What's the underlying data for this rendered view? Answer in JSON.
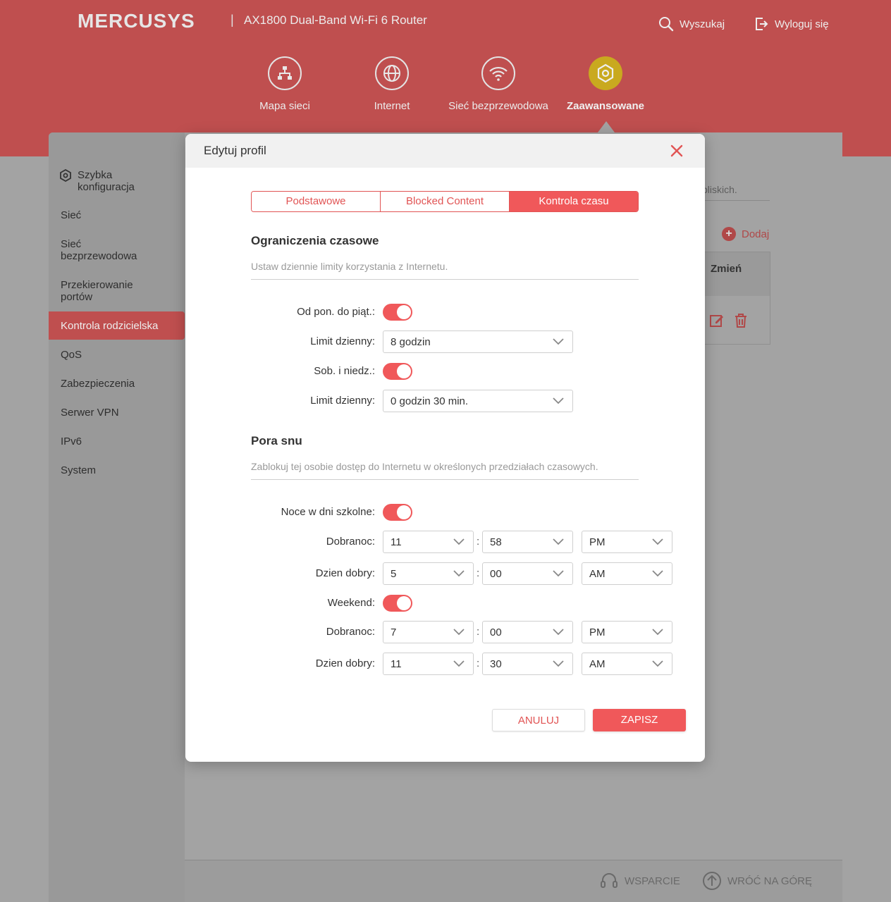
{
  "header": {
    "brand": "MERCUSYS",
    "model": "AX1800 Dual-Band Wi-Fi 6 Router",
    "search_label": "Wyszukaj",
    "logout_label": "Wyloguj się"
  },
  "nav": {
    "items": [
      {
        "label": "Mapa sieci",
        "icon": "network-map-icon"
      },
      {
        "label": "Internet",
        "icon": "globe-icon"
      },
      {
        "label": "Sieć bezprzewodowa",
        "icon": "wifi-icon"
      },
      {
        "label": "Zaawansowane",
        "icon": "gear-icon",
        "active": true
      }
    ]
  },
  "sidebar": {
    "items": [
      {
        "label": "Szybka konfiguracja"
      },
      {
        "label": "Sieć"
      },
      {
        "label": "Sieć bezprzewodowa"
      },
      {
        "label": "Przekierowanie portów"
      },
      {
        "label": "Kontrola rodzicielska",
        "active": true
      },
      {
        "label": "QoS"
      },
      {
        "label": "Zabezpieczenia"
      },
      {
        "label": "Serwer VPN"
      },
      {
        "label": "IPv6"
      },
      {
        "label": "System"
      }
    ]
  },
  "background": {
    "note_fragment": "bliskich.",
    "add_label": "Dodaj",
    "table_header_edit": "Zmień"
  },
  "footer": {
    "support_label": "WSPARCIE",
    "top_label": "WRÓĆ NA GÓRĘ"
  },
  "modal": {
    "title": "Edytuj profil",
    "tabs": [
      "Podstawowe",
      "Blocked Content",
      "Kontrola czasu"
    ],
    "active_tab": "Kontrola czasu",
    "time_limits": {
      "title": "Ograniczenia czasowe",
      "description": "Ustaw dziennie limity korzystania z Internetu.",
      "weekdays_label": "Od pon. do piąt.:",
      "weekdays_enabled": true,
      "weekdays_limit_label": "Limit dzienny:",
      "weekdays_limit": "8 godzin",
      "weekend_label": "Sob. i niedz.:",
      "weekend_enabled": true,
      "weekend_limit_label": "Limit dzienny:",
      "weekend_limit": "0 godzin 30 min."
    },
    "bedtime": {
      "title": "Pora snu",
      "description": "Zablokuj tej osobie dostęp do Internetu w określonych przedziałach czasowych.",
      "school_nights_label": "Noce w dni szkolne:",
      "school_nights_enabled": true,
      "school_bed_label": "Dobranoc:",
      "school_bed": {
        "hour": "11",
        "minute": "58",
        "period": "PM"
      },
      "school_wake_label": "Dzien dobry:",
      "school_wake": {
        "hour": "5",
        "minute": "00",
        "period": "AM"
      },
      "weekend_label": "Weekend:",
      "weekend_enabled": true,
      "weekend_bed_label": "Dobranoc:",
      "weekend_bed": {
        "hour": "7",
        "minute": "00",
        "period": "PM"
      },
      "weekend_wake_label": "Dzien dobry:",
      "weekend_wake": {
        "hour": "11",
        "minute": "30",
        "period": "AM"
      }
    },
    "time_separator": ":",
    "cancel_label": "ANULUJ",
    "save_label": "ZAPISZ"
  },
  "colors": {
    "accent": "#f0585a",
    "header_dimmed": "#bf4f4f",
    "active_nav_dimmed": "#c9a91f"
  }
}
